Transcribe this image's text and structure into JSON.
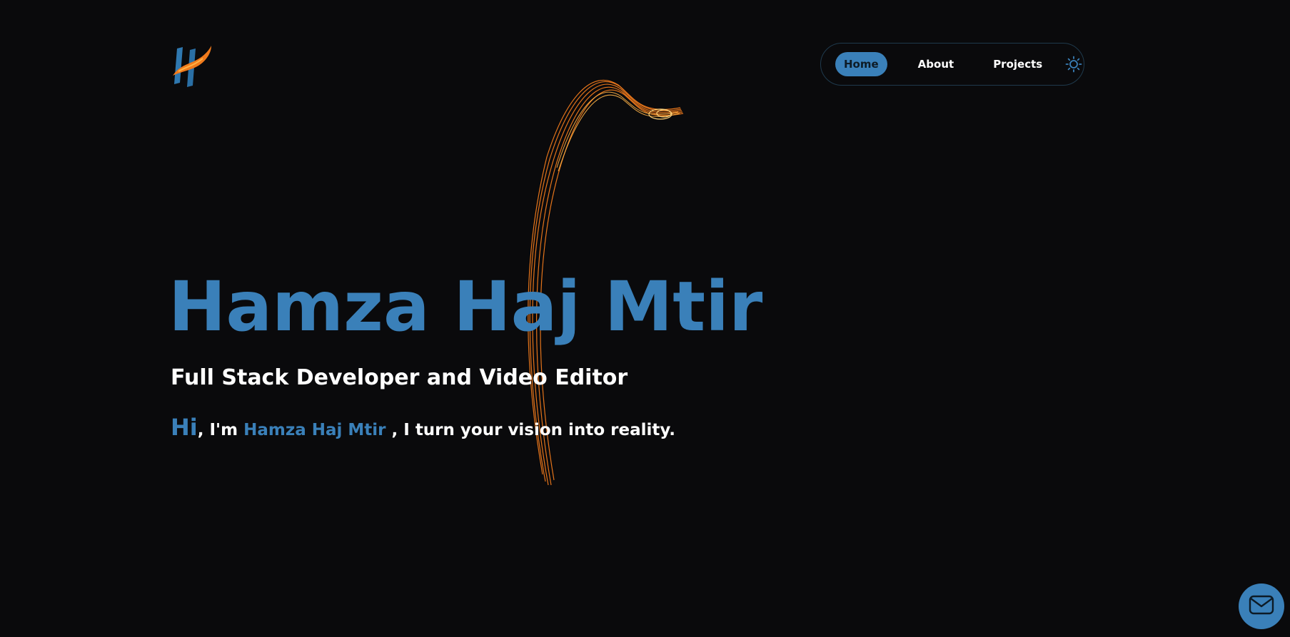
{
  "header": {
    "logo_icon": "hf-logo-icon",
    "nav": {
      "home_label": "Home",
      "about_label": "About",
      "projects_label": "Projects",
      "theme_icon": "sun-icon"
    }
  },
  "hero": {
    "title": "Hamza Haj Mtir",
    "subtitle": "Full Stack Developer and Video Editor",
    "intro": {
      "hi": "Hi",
      "im": ", I'm ",
      "name": "Hamza Haj Mtir",
      "rest": " , I turn your vision into reality."
    }
  },
  "contact": {
    "icon": "mail-icon"
  },
  "colors": {
    "background": "#0a0a0c",
    "accent": "#3a80b9",
    "text": "#ffffff",
    "swirl": "#f07a1c"
  }
}
